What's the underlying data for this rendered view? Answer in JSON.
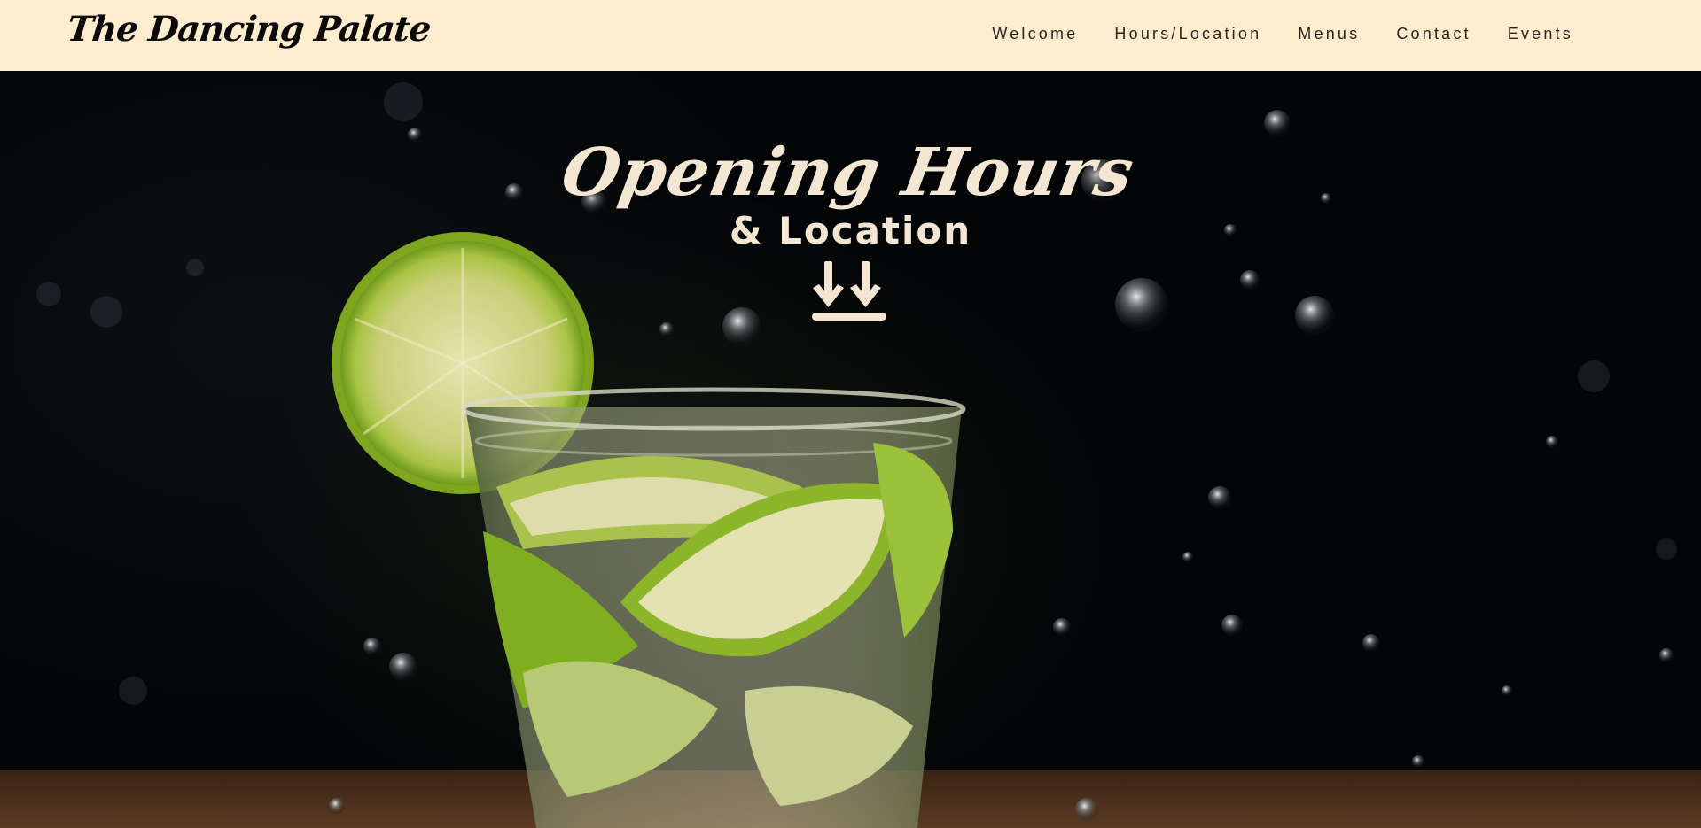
{
  "header": {
    "brand": "The Dancing Palate",
    "nav": [
      {
        "label": "Welcome"
      },
      {
        "label": "Hours/Location"
      },
      {
        "label": "Menus"
      },
      {
        "label": "Contact"
      },
      {
        "label": "Events"
      }
    ]
  },
  "hero": {
    "title": "Opening Hours",
    "subtitle": "& Location",
    "scroll_icon": "double-arrow-down-icon",
    "background_image": "lime-cocktail-photo"
  },
  "colors": {
    "nav_background": "#fdeccd",
    "brand_text": "#0c0a08",
    "hero_text": "#f3e7d3",
    "hero_background": "#040507",
    "lime": "#9bc23c"
  }
}
